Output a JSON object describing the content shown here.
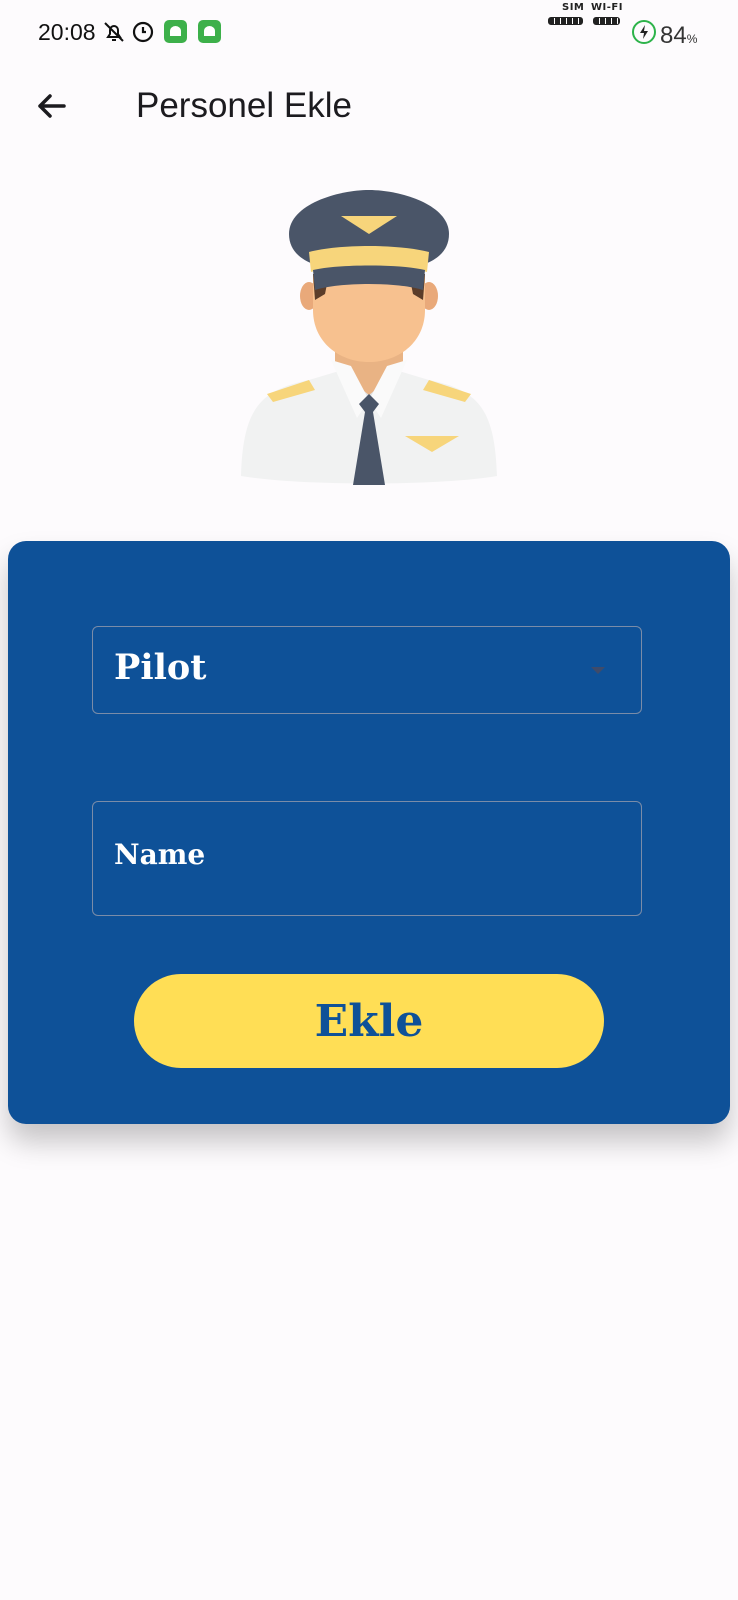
{
  "status_bar": {
    "time": "20:08",
    "sim_label": "SIM",
    "wifi_label": "WI-FI",
    "battery_percent": "84",
    "battery_unit": "%",
    "icons": [
      "bell-off-icon",
      "clock-icon",
      "android-icon",
      "android-icon"
    ]
  },
  "app_bar": {
    "back_icon": "arrow-back-icon",
    "title": "Personel Ekle"
  },
  "avatar": {
    "icon": "pilot-avatar"
  },
  "form": {
    "role_select": {
      "value": "Pilot"
    },
    "name_field": {
      "label": "Name",
      "value": ""
    },
    "submit_label": "Ekle"
  },
  "colors": {
    "card_background": "#0e5198",
    "button_background": "#ffde55",
    "button_text": "#0e5198",
    "page_background": "#fdfbfd"
  }
}
